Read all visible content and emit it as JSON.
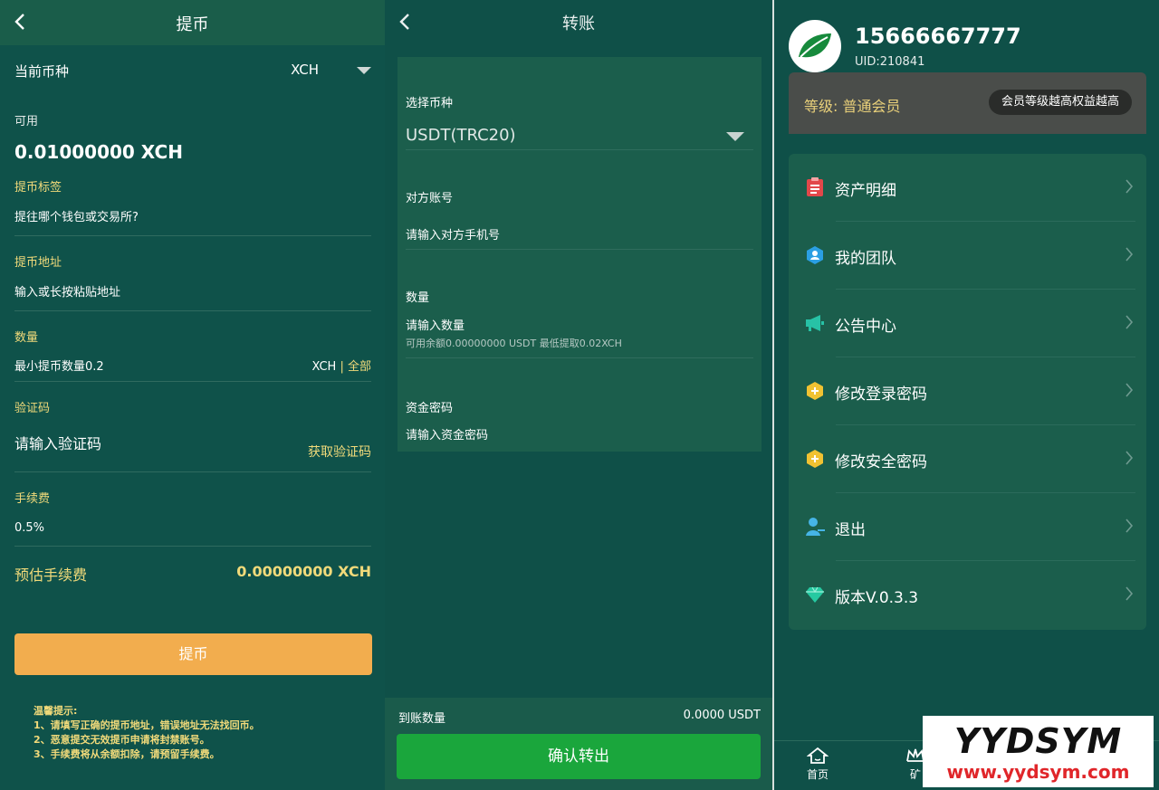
{
  "withdraw": {
    "title": "提币",
    "current_coin_label": "当前币种",
    "current_coin_value": "XCH",
    "available_label": "可用",
    "available_amount": "0.01000000 XCH",
    "tag_label": "提币标签",
    "tag_placeholder": "提往哪个钱包或交易所?",
    "address_label": "提币地址",
    "address_placeholder": "输入或长按粘贴地址",
    "quantity_label": "数量",
    "quantity_placeholder": "最小提币数量0.2",
    "quantity_unit": "XCH",
    "quantity_sep": "|",
    "quantity_all": "全部",
    "code_label": "验证码",
    "code_placeholder": "请输入验证码",
    "get_code": "获取验证码",
    "fee_label": "手续费",
    "fee_value": "0.5%",
    "est_fee_label": "预估手续费",
    "est_fee_value": "0.00000000 XCH",
    "submit": "提币",
    "tips_title": "温馨提示:",
    "tips": [
      "1、请填写正确的提币地址，错误地址无法找回币。",
      "2、恶意提交无效提币申请将封禁账号。",
      "3、手续费将从余额扣除，请预留手续费。"
    ]
  },
  "transfer": {
    "title": "转账",
    "select_coin_label": "选择币种",
    "select_coin_value": "USDT(TRC20)",
    "account_label": "对方账号",
    "account_placeholder": "请输入对方手机号",
    "quantity_label": "数量",
    "quantity_placeholder": "请输入数量",
    "quantity_hint": "可用余额0.00000000 USDT 最低提取0.02XCH",
    "fund_pwd_label": "资金密码",
    "fund_pwd_placeholder": "请输入资金密码",
    "arrival_label": "到账数量",
    "arrival_value": "0.0000 USDT",
    "confirm": "确认转出"
  },
  "profile": {
    "phone": "15666667777",
    "uid": "UID:210841",
    "level": "等级: 普通会员",
    "level_pill": "会员等级越高权益越高",
    "menu": [
      {
        "label": "资产明细",
        "icon": "clipboard-icon",
        "color": "#e2474a"
      },
      {
        "label": "我的团队",
        "icon": "team-icon",
        "color": "#2b9fe3"
      },
      {
        "label": "公告中心",
        "icon": "megaphone-icon",
        "color": "#27c2a6"
      },
      {
        "label": "修改登录密码",
        "icon": "lock-hex-icon",
        "color": "#f1c232"
      },
      {
        "label": "修改安全密码",
        "icon": "shield-hex-icon",
        "color": "#f1c232"
      },
      {
        "label": "退出",
        "icon": "user-exit-icon",
        "color": "#46b4e6"
      },
      {
        "label": "版本V.0.3.3",
        "icon": "diamond-icon",
        "color": "#26c9a1"
      }
    ],
    "tabs": [
      "首页",
      "矿"
    ]
  },
  "watermark": {
    "logo": "YYDSYM",
    "url": "www.yydsym.com"
  },
  "colors": {
    "background": "#0f5048",
    "card": "#1b5e4c",
    "accent_yellow": "#f1da7a",
    "submit_orange": "#f2ad4e",
    "confirm_green": "#1aa63c"
  }
}
